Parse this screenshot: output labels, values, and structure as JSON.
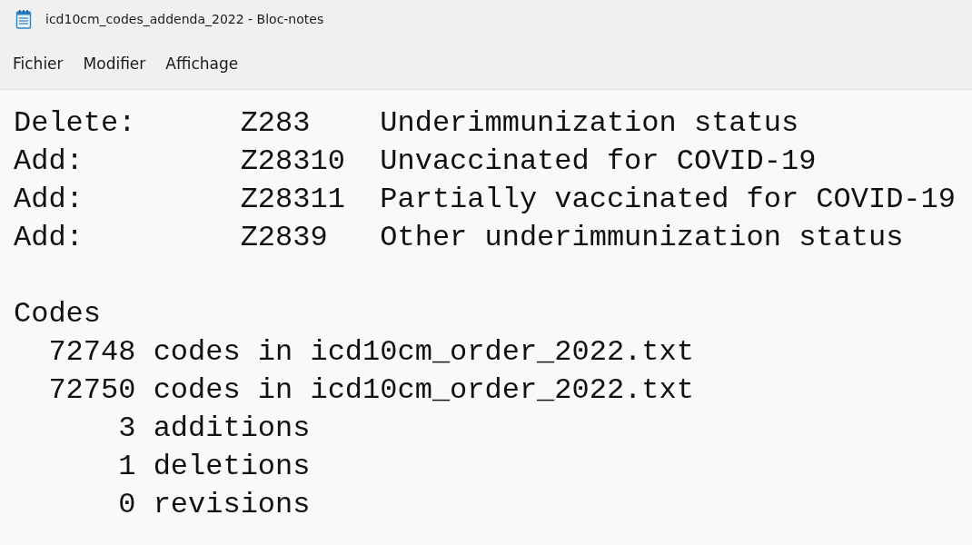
{
  "window": {
    "title": "icd10cm_codes_addenda_2022 - Bloc-notes"
  },
  "menu": [
    "Fichier",
    "Modifier",
    "Affichage"
  ],
  "document": {
    "paragraphs": [
      [
        "Delete:      Z283    Underimmunization status",
        "Add:         Z28310  Unvaccinated for COVID-19",
        "Add:         Z28311  Partially vaccinated for COVID-19",
        "Add:         Z2839   Other underimmunization status"
      ],
      [
        "Codes",
        "  72748 codes in icd10cm_order_2022.txt",
        "  72750 codes in icd10cm_order_2022.txt",
        "      3 additions",
        "      1 deletions",
        "      0 revisions"
      ]
    ]
  }
}
